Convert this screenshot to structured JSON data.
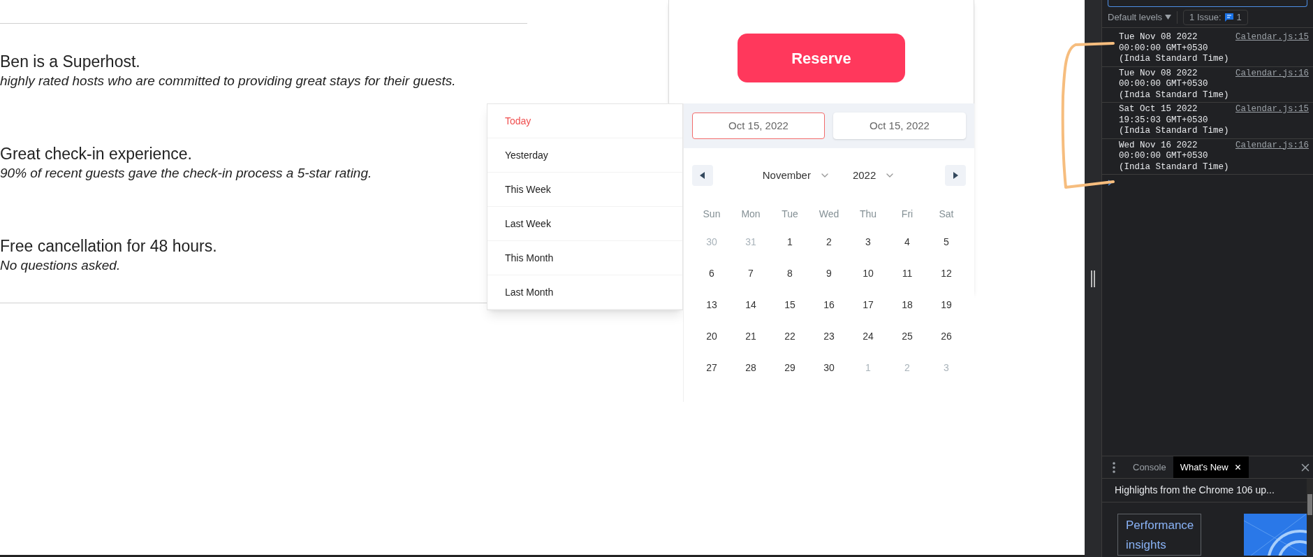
{
  "host_features": [
    {
      "title": "Ben is a Superhost.",
      "description": "highly rated hosts who are committed to providing great stays for their guests."
    },
    {
      "title": "Great check-in experience.",
      "description": "90% of recent guests gave the check-in process a 5-star rating."
    },
    {
      "title": "Free cancellation for 48 hours.",
      "description": "No questions asked."
    }
  ],
  "booking_card": {
    "reserve_button": "Reserve"
  },
  "date_picker": {
    "presets": [
      {
        "label": "Today",
        "selected": true
      },
      {
        "label": "Yesterday",
        "selected": false
      },
      {
        "label": "This Week",
        "selected": false
      },
      {
        "label": "Last Week",
        "selected": false
      },
      {
        "label": "This Month",
        "selected": false
      },
      {
        "label": "Last Month",
        "selected": false
      }
    ],
    "date_inputs": [
      {
        "value": "Oct 15, 2022",
        "selected": true
      },
      {
        "value": "Oct 15, 2022",
        "selected": false
      }
    ],
    "month": "November",
    "year": "2022",
    "weekdays": [
      "Sun",
      "Mon",
      "Tue",
      "Wed",
      "Thu",
      "Fri",
      "Sat"
    ],
    "weeks": [
      [
        {
          "day": "30",
          "outside": true
        },
        {
          "day": "31",
          "outside": true
        },
        {
          "day": "1",
          "outside": false
        },
        {
          "day": "2",
          "outside": false
        },
        {
          "day": "3",
          "outside": false
        },
        {
          "day": "4",
          "outside": false
        },
        {
          "day": "5",
          "outside": false
        }
      ],
      [
        {
          "day": "6",
          "outside": false
        },
        {
          "day": "7",
          "outside": false
        },
        {
          "day": "8",
          "outside": false
        },
        {
          "day": "9",
          "outside": false
        },
        {
          "day": "10",
          "outside": false
        },
        {
          "day": "11",
          "outside": false
        },
        {
          "day": "12",
          "outside": false
        }
      ],
      [
        {
          "day": "13",
          "outside": false
        },
        {
          "day": "14",
          "outside": false
        },
        {
          "day": "15",
          "outside": false
        },
        {
          "day": "16",
          "outside": false
        },
        {
          "day": "17",
          "outside": false
        },
        {
          "day": "18",
          "outside": false
        },
        {
          "day": "19",
          "outside": false
        }
      ],
      [
        {
          "day": "20",
          "outside": false
        },
        {
          "day": "21",
          "outside": false
        },
        {
          "day": "22",
          "outside": false
        },
        {
          "day": "23",
          "outside": false
        },
        {
          "day": "24",
          "outside": false
        },
        {
          "day": "25",
          "outside": false
        },
        {
          "day": "26",
          "outside": false
        }
      ],
      [
        {
          "day": "27",
          "outside": false
        },
        {
          "day": "28",
          "outside": false
        },
        {
          "day": "29",
          "outside": false
        },
        {
          "day": "30",
          "outside": false
        },
        {
          "day": "1",
          "outside": true
        },
        {
          "day": "2",
          "outside": true
        },
        {
          "day": "3",
          "outside": true
        }
      ]
    ]
  },
  "devtools": {
    "levels_dropdown": "Default levels",
    "issues_label": "1 Issue:",
    "issues_count": "1",
    "logs": [
      {
        "message": "Tue Nov 08 2022 00:00:00 GMT+0530 (India Standard Time)",
        "source": "Calendar.js:15"
      },
      {
        "message": "Tue Nov 08 2022 00:00:00 GMT+0530 (India Standard Time)",
        "source": "Calendar.js:16"
      },
      {
        "message": "Sat Oct 15 2022 19:35:03 GMT+0530 (India Standard Time)",
        "source": "Calendar.js:15"
      },
      {
        "message": "Wed Nov 16 2022 00:00:00 GMT+0530 (India Standard Time)",
        "source": "Calendar.js:16"
      }
    ],
    "drawer_tabs": [
      {
        "label": "Console",
        "selected": false,
        "closable": false
      },
      {
        "label": "What's New",
        "selected": true,
        "closable": true
      }
    ],
    "whats_new_title": "Highlights from the Chrome 106 up...",
    "feature_link": "Performance insights"
  }
}
